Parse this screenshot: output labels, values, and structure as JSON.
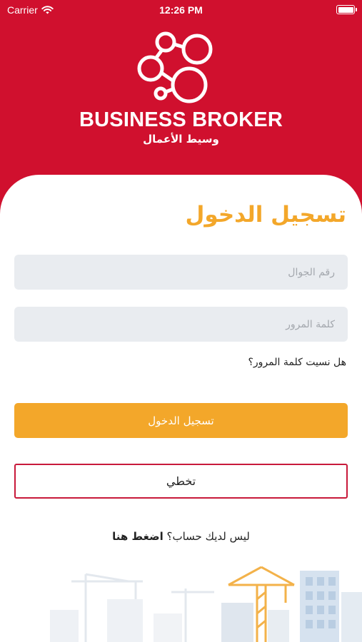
{
  "status_bar": {
    "carrier": "Carrier",
    "time": "12:26 PM"
  },
  "brand": {
    "name_en": "BUSINESS BROKER",
    "name_ar": "وسيط الأعمال"
  },
  "login": {
    "title": "تسجيل الدخول",
    "phone_placeholder": "رقم الجوال",
    "phone_value": "",
    "password_placeholder": "كلمة المرور",
    "password_value": "",
    "forgot_password": "هل نسيت كلمة المرور؟",
    "login_button": "تسجيل الدخول",
    "skip_button": "تخطي",
    "no_account_text": "ليس لديك حساب؟",
    "signup_link": "اضغط هنا"
  },
  "colors": {
    "header_red": "#d0102e",
    "accent_orange": "#f3a72a",
    "field_bg": "#e9ecf0",
    "skip_border": "#c8193a"
  },
  "icons": {
    "wifi": "wifi-icon",
    "battery": "battery-icon",
    "logo": "business-broker-logo",
    "background": "city-skyline-illustration"
  }
}
